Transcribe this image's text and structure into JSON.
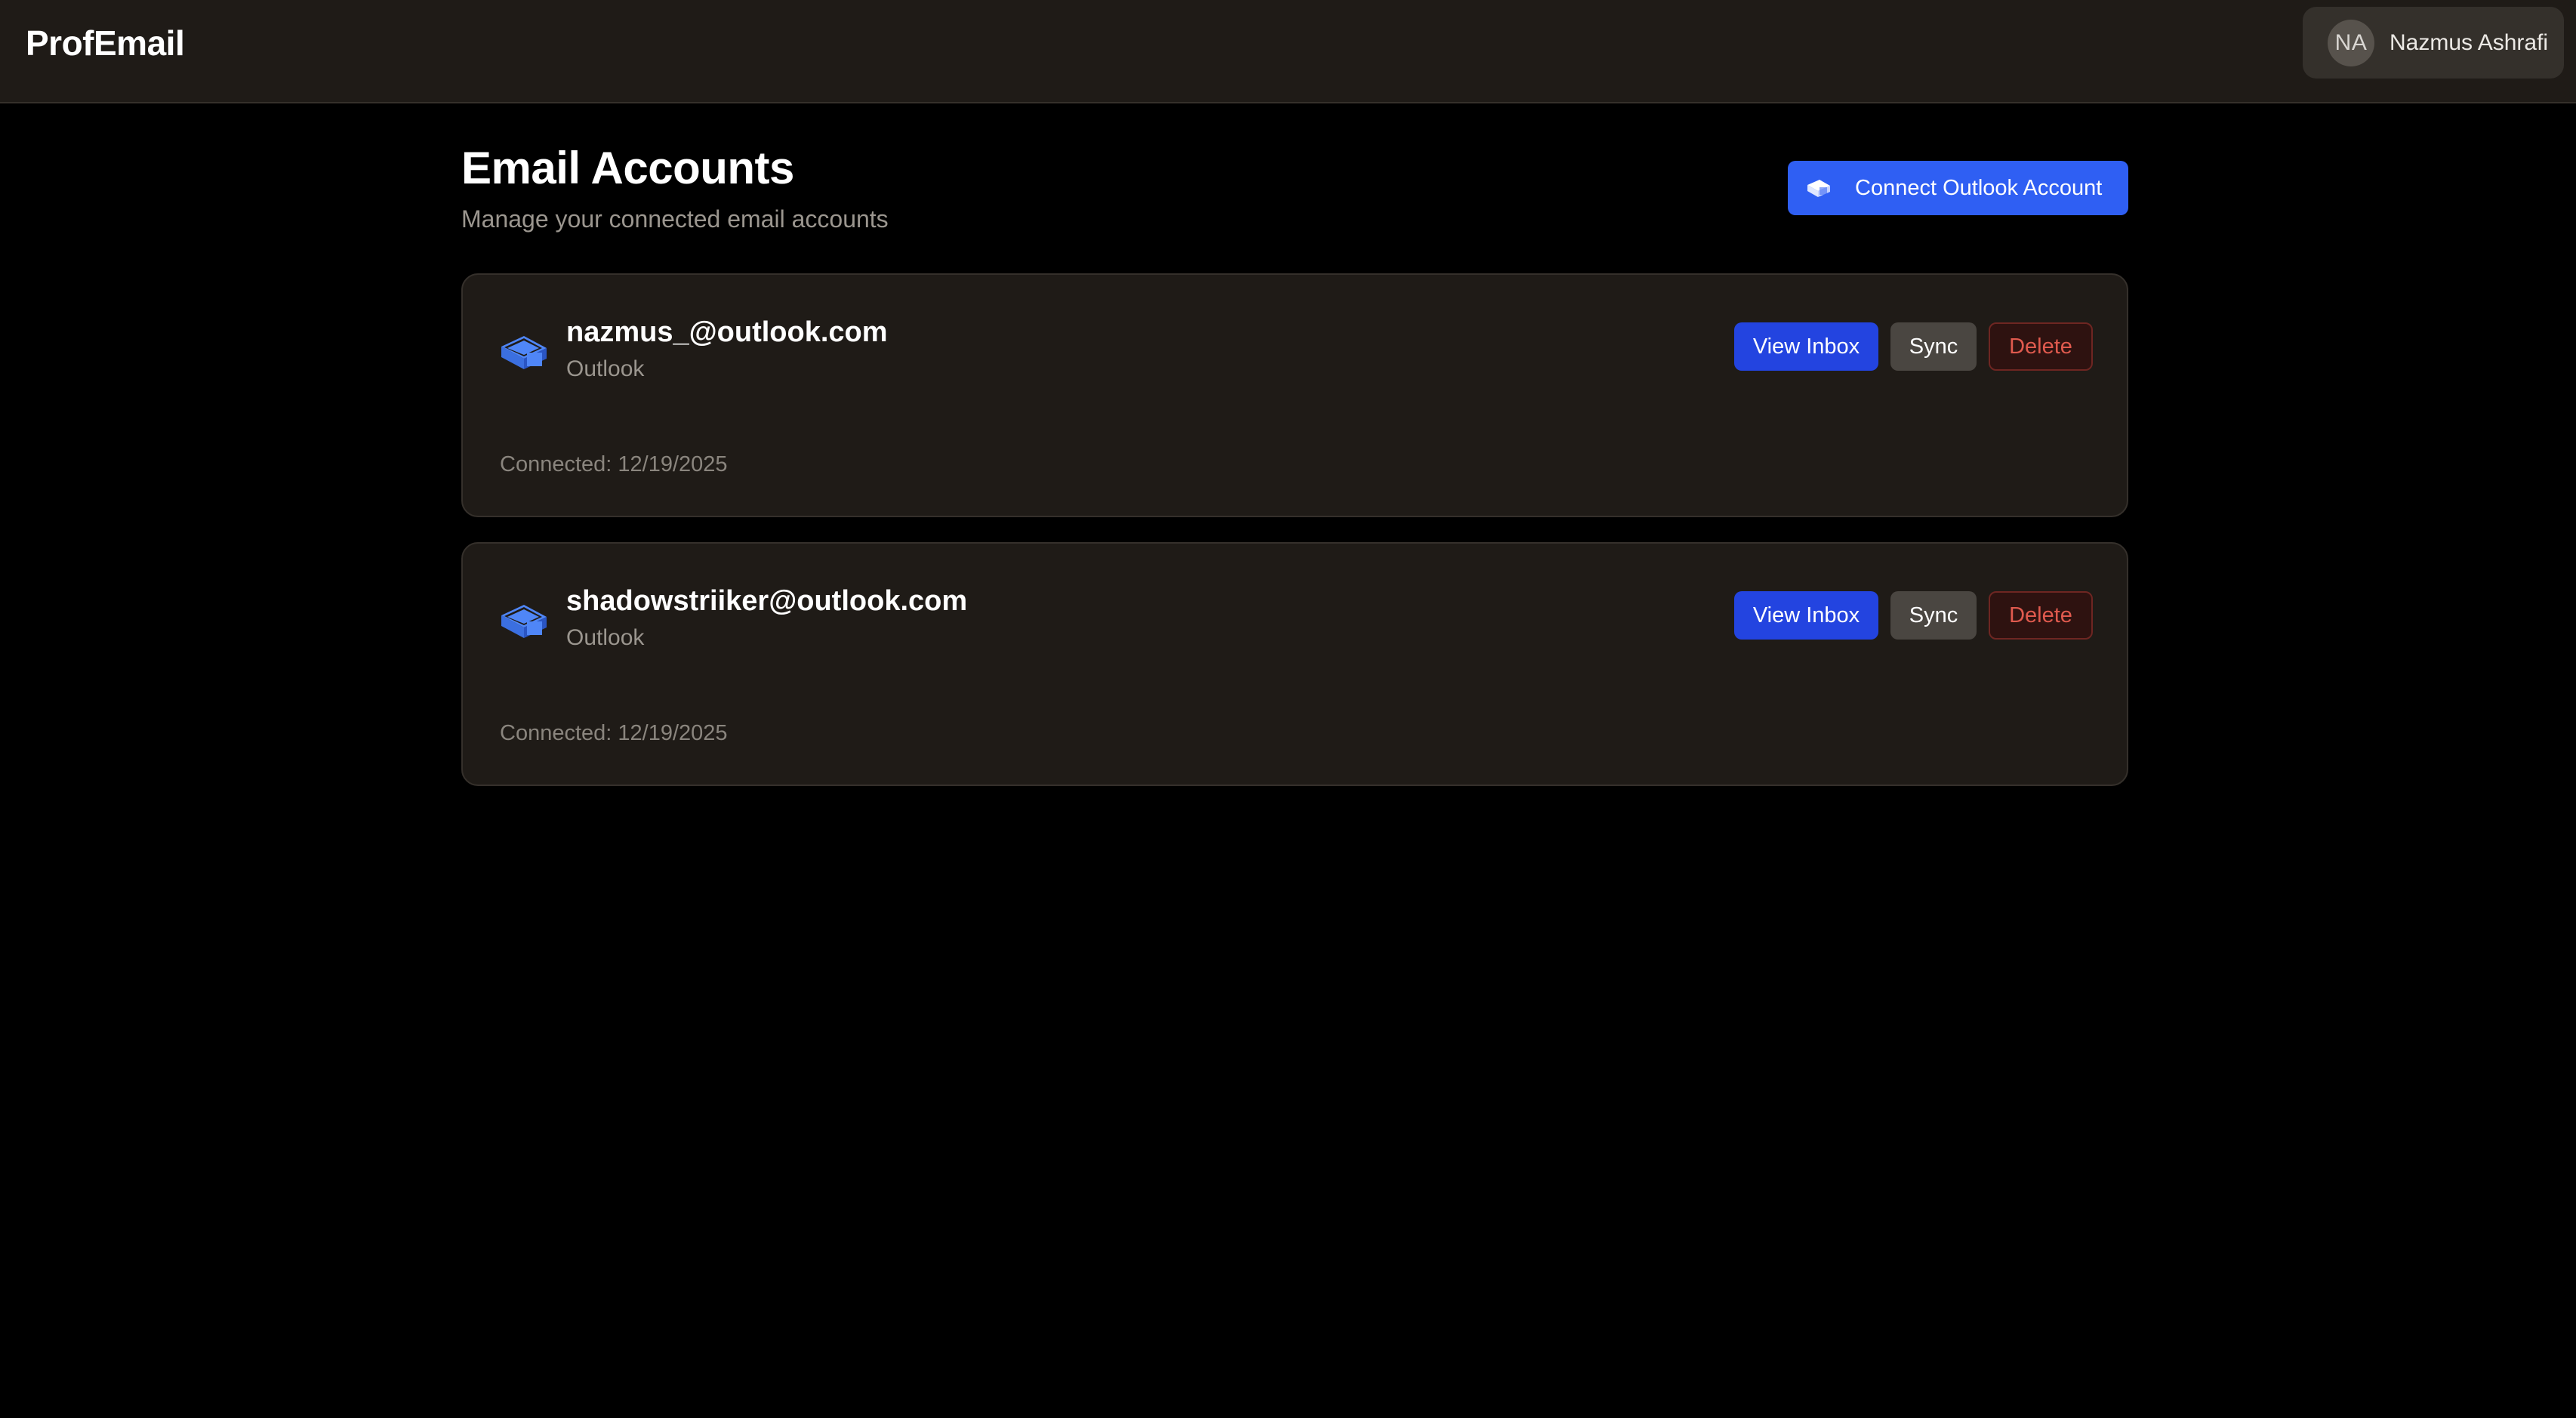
{
  "app": {
    "brand": "ProfEmail"
  },
  "user": {
    "initials": "NA",
    "name": "Nazmus Ashrafi"
  },
  "page": {
    "title": "Email Accounts",
    "subtitle": "Manage your connected email accounts",
    "connect_button_label": "Connect Outlook Account"
  },
  "accounts": [
    {
      "email": "nazmus_@outlook.com",
      "provider": "Outlook",
      "connected": "Connected: 12/19/2025",
      "actions": {
        "view": "View Inbox",
        "sync": "Sync",
        "delete": "Delete"
      }
    },
    {
      "email": "shadowstriiker@outlook.com",
      "provider": "Outlook",
      "connected": "Connected: 12/19/2025",
      "actions": {
        "view": "View Inbox",
        "sync": "Sync",
        "delete": "Delete"
      }
    }
  ],
  "icons": {
    "brand_mail_icon": "outlook-mail-icon"
  },
  "colors": {
    "accent": "#2f5ff3",
    "view_button": "#2344e0",
    "sync_button": "#4a4641",
    "delete_text": "#e05a4e",
    "icon_blue": "#4f86f7"
  }
}
